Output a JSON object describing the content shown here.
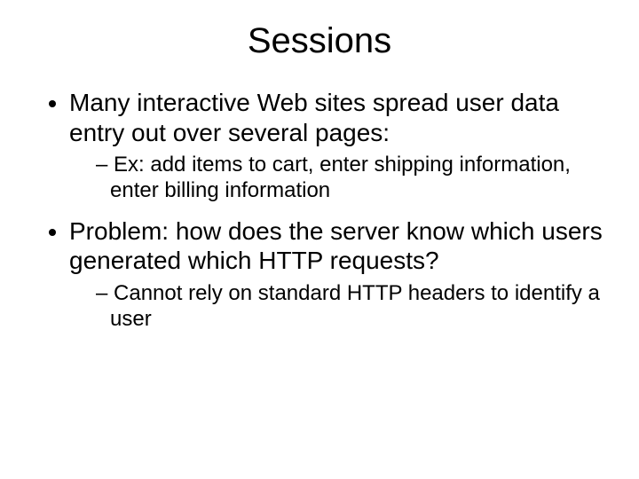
{
  "title": "Sessions",
  "bullet1": "Many interactive Web sites spread user data entry out over several pages:",
  "bullet1_sub1": "Ex: add items to cart, enter shipping information, enter billing information",
  "bullet2": "Problem: how does the server know which users generated which HTTP requests?",
  "bullet2_sub1": "Cannot rely on standard HTTP headers to identify a user"
}
